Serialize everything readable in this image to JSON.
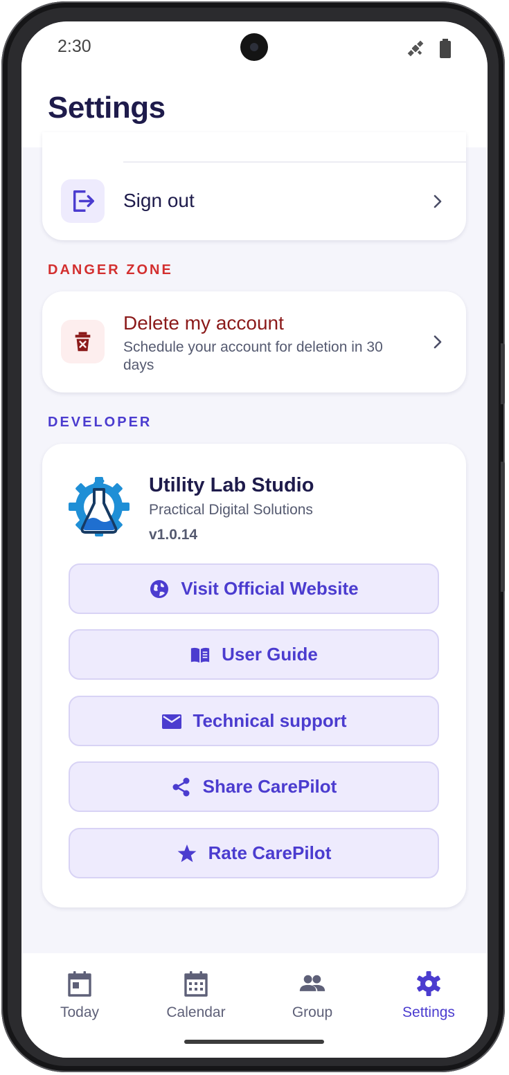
{
  "status": {
    "time": "2:30",
    "signal_icon": "satellite-icon",
    "battery_icon": "battery-icon"
  },
  "header": {
    "title": "Settings"
  },
  "account": {
    "sign_out_label": "Sign out",
    "sign_out_icon": "logout-icon"
  },
  "danger": {
    "section_label": "DANGER ZONE",
    "delete_title": "Delete my account",
    "delete_subtitle": "Schedule your account for deletion in 30 days",
    "delete_icon": "trash-icon"
  },
  "developer": {
    "section_label": "DEVELOPER",
    "name": "Utility Lab Studio",
    "tagline": "Practical Digital Solutions",
    "version": "v1.0.14",
    "buttons": [
      {
        "label": "Visit Official Website",
        "icon": "globe-icon"
      },
      {
        "label": "User Guide",
        "icon": "book-icon"
      },
      {
        "label": "Technical support",
        "icon": "mail-icon"
      },
      {
        "label": "Share CarePilot",
        "icon": "share-icon"
      },
      {
        "label": "Rate CarePilot",
        "icon": "star-icon"
      }
    ]
  },
  "nav": {
    "items": [
      {
        "label": "Today",
        "icon": "calendar-today-icon"
      },
      {
        "label": "Calendar",
        "icon": "calendar-grid-icon"
      },
      {
        "label": "Group",
        "icon": "group-icon"
      },
      {
        "label": "Settings",
        "icon": "gear-icon"
      }
    ],
    "active": "Settings"
  },
  "colors": {
    "accent": "#4b3ccf",
    "danger_label": "#d32f2f",
    "title": "#1e1b4b",
    "button_bg": "#eeebfd",
    "screen_bg": "#f5f5fb"
  }
}
